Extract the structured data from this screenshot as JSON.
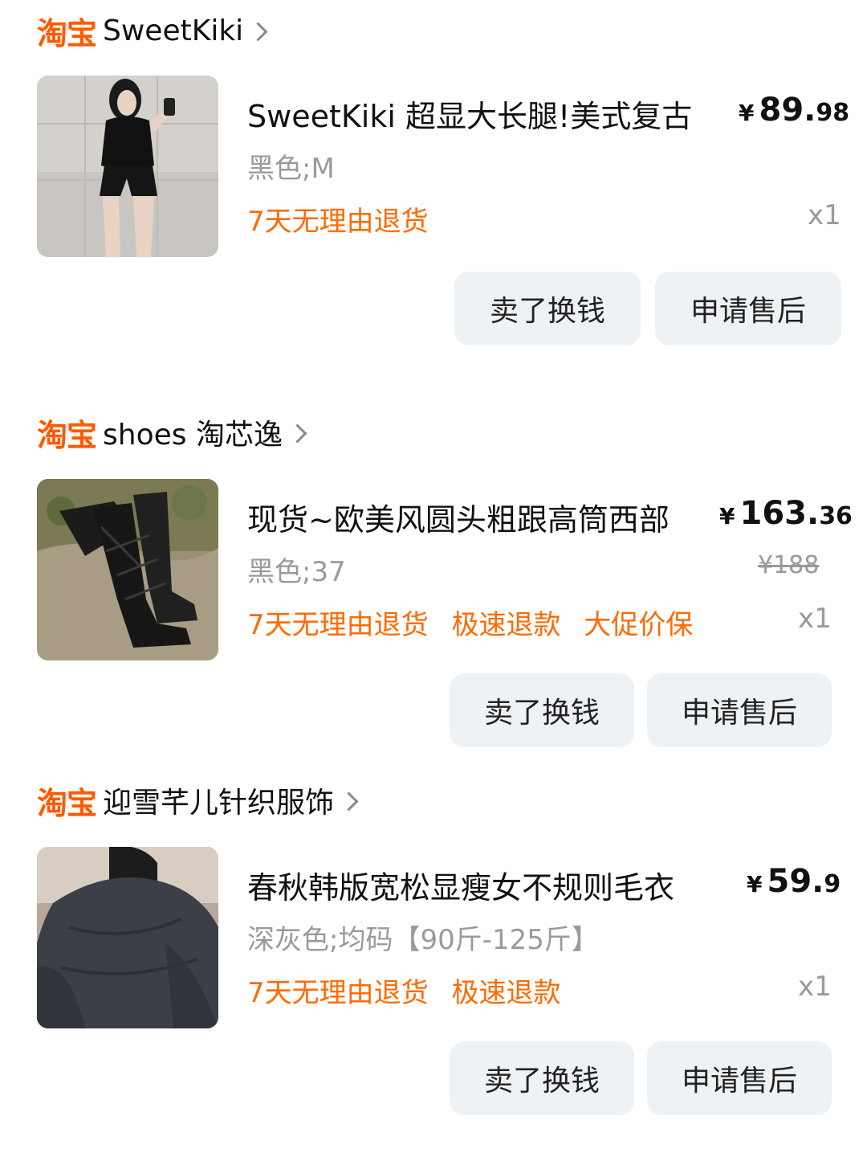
{
  "orders": [
    {
      "shop_logo": "淘宝",
      "shop_name": "SweetKiki",
      "title": "SweetKiki 超显大长腿!美式复古",
      "price_symbol": "¥",
      "price_int": "89.",
      "price_dec": "98",
      "spec": "黑色;M",
      "original_price": "",
      "tags": [
        "7天无理由退货"
      ],
      "qty": "x1",
      "thumbnail_icon": "product-image-black-outfit",
      "buttons": {
        "sell": "卖了换钱",
        "after_sale": "申请售后"
      }
    },
    {
      "shop_logo": "淘宝",
      "shop_name": "shoes 淘芯逸",
      "title": "现货~欧美风圆头粗跟高筒西部",
      "price_symbol": "¥",
      "price_int": "163.",
      "price_dec": "36",
      "spec": "黑色;37",
      "original_price": "¥188",
      "tags": [
        "7天无理由退货",
        "极速退款",
        "大促价保"
      ],
      "qty": "x1",
      "thumbnail_icon": "product-image-black-boots",
      "buttons": {
        "sell": "卖了换钱",
        "after_sale": "申请售后"
      }
    },
    {
      "shop_logo": "淘宝",
      "shop_name": "迎雪芊儿针织服饰",
      "title": "春秋韩版宽松显瘦女不规则毛衣",
      "price_symbol": "¥",
      "price_int": "59.",
      "price_dec": "9",
      "spec": "深灰色;均码【90斤-125斤】",
      "original_price": "",
      "tags": [
        "7天无理由退货",
        "极速退款"
      ],
      "qty": "x1",
      "thumbnail_icon": "product-image-grey-sweater",
      "buttons": {
        "sell": "卖了换钱",
        "after_sale": "申请售后"
      }
    }
  ],
  "colors": {
    "brand_orange": "#ff5a00",
    "tag_orange": "#ff6a00",
    "muted_text": "#9a9a9a",
    "button_bg": "#eef2f5"
  }
}
